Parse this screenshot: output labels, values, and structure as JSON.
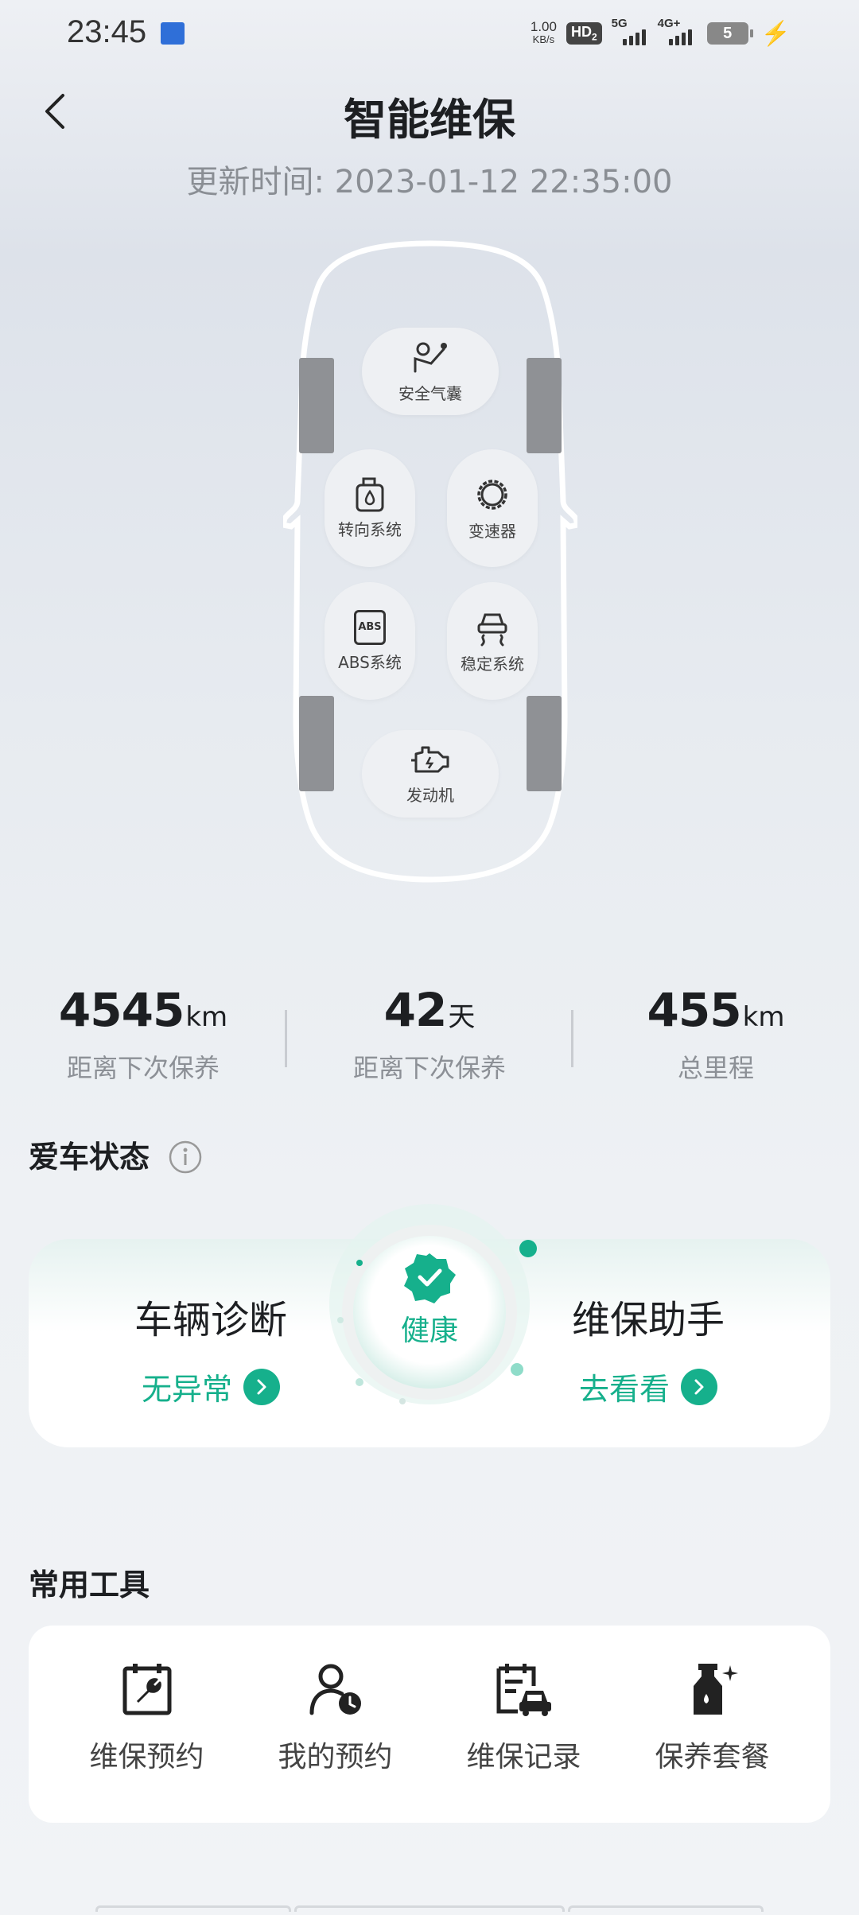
{
  "status_bar": {
    "time": "23:45",
    "net_speed": "1.00",
    "net_unit": "KB/s",
    "hd": "HD",
    "hd_sub": "2",
    "sig1": "5G",
    "sig2": "4G+",
    "battery": "5"
  },
  "header": {
    "title": "智能维保",
    "update_time": "更新时间: 2023-01-12 22:35:00"
  },
  "car_systems": {
    "airbag": "安全气囊",
    "steering": "转向系统",
    "transmission": "变速器",
    "abs": "ABS系统",
    "stability": "稳定系统",
    "engine": "发动机",
    "abs_badge": "ABS"
  },
  "stats": [
    {
      "value": "4545",
      "unit": "km",
      "label": "距离下次保养"
    },
    {
      "value": "42",
      "unit": "天",
      "label": "距离下次保养"
    },
    {
      "value": "455",
      "unit": "km",
      "label": "总里程"
    }
  ],
  "car_status": {
    "title": "爱车状态",
    "health": "健康",
    "diagnosis_title": "车辆诊断",
    "diagnosis_link": "无异常",
    "assistant_title": "维保助手",
    "assistant_link": "去看看"
  },
  "tools": {
    "title": "常用工具",
    "items": [
      {
        "label": "维保预约",
        "icon": "calendar-wrench-icon"
      },
      {
        "label": "我的预约",
        "icon": "user-clock-icon"
      },
      {
        "label": "维保记录",
        "icon": "document-car-icon"
      },
      {
        "label": "保养套餐",
        "icon": "oil-bottle-icon"
      }
    ]
  },
  "colors": {
    "accent": "#16b08c",
    "title": "#1d1f22",
    "muted": "#8c9096"
  }
}
